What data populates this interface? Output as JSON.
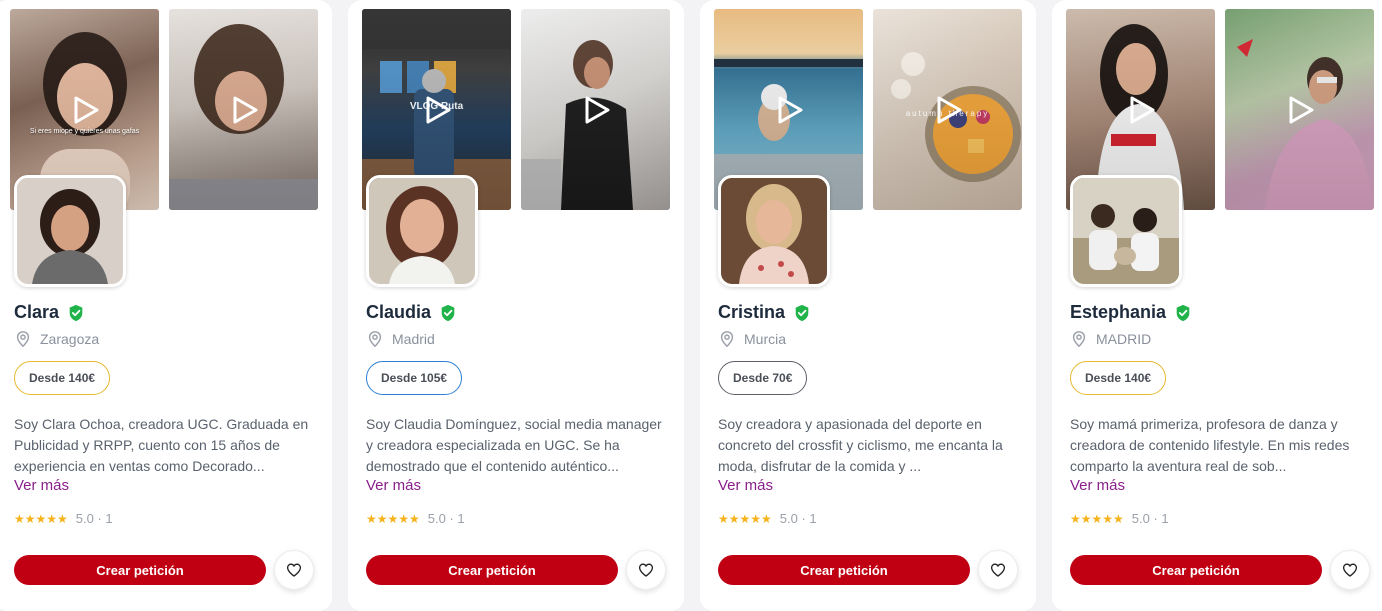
{
  "cards": [
    {
      "name": "Clara",
      "location": "Zaragoza",
      "price": "Desde 140€",
      "description": "Soy Clara Ochoa, creadora UGC. Graduada en Publicidad y RRPP, cuento con 15 años de experiencia en ventas como Decorado...",
      "more": "Ver más",
      "stars": "★★★★★",
      "rating": "5.0 · 1",
      "cta": "Crear petición",
      "thumb1_caption": "Si eres miope y quieres unas gafas",
      "thumb2_caption": ""
    },
    {
      "name": "Claudia",
      "location": "Madrid",
      "price": "Desde 105€",
      "description": "Soy Claudia Domínguez, social media manager y creadora especializada en UGC. Se ha demostrado que el contenido auténtico...",
      "more": "Ver más",
      "stars": "★★★★★",
      "rating": "5.0 · 1",
      "cta": "Crear petición",
      "thumb1_caption": "VLOG Ruta",
      "thumb2_caption": ""
    },
    {
      "name": "Cristina",
      "location": "Murcia",
      "price": "Desde 70€",
      "description": "Soy creadora y apasionada del deporte en concreto del crossfit y ciclismo, me encanta la moda, disfrutar de la comida y ...",
      "more": "Ver más",
      "stars": "★★★★★",
      "rating": "5.0 · 1",
      "cta": "Crear petición",
      "thumb1_caption": "",
      "thumb2_caption": "autumn therapy"
    },
    {
      "name": "Estephania",
      "location": "MADRID",
      "price": "Desde 140€",
      "description": "Soy mamá primeriza, profesora de danza y creadora de contenido lifestyle. En mis redes comparto la aventura real de sob...",
      "more": "Ver más",
      "stars": "★★★★★",
      "rating": "5.0 · 1",
      "cta": "Crear petición",
      "thumb1_caption": "",
      "thumb2_caption": ""
    }
  ],
  "colors": {
    "brand_red": "#c00012",
    "verified_green": "#1fb34a",
    "star_yellow": "#f5b21b",
    "link_purple": "#8a1f8a",
    "price_border_yellow": "#e6b92e",
    "price_border_blue": "#2f7fd3",
    "price_border_gray": "#5c6168"
  },
  "icons": [
    "play-icon",
    "verified-badge-icon",
    "location-pin-icon",
    "heart-icon"
  ]
}
